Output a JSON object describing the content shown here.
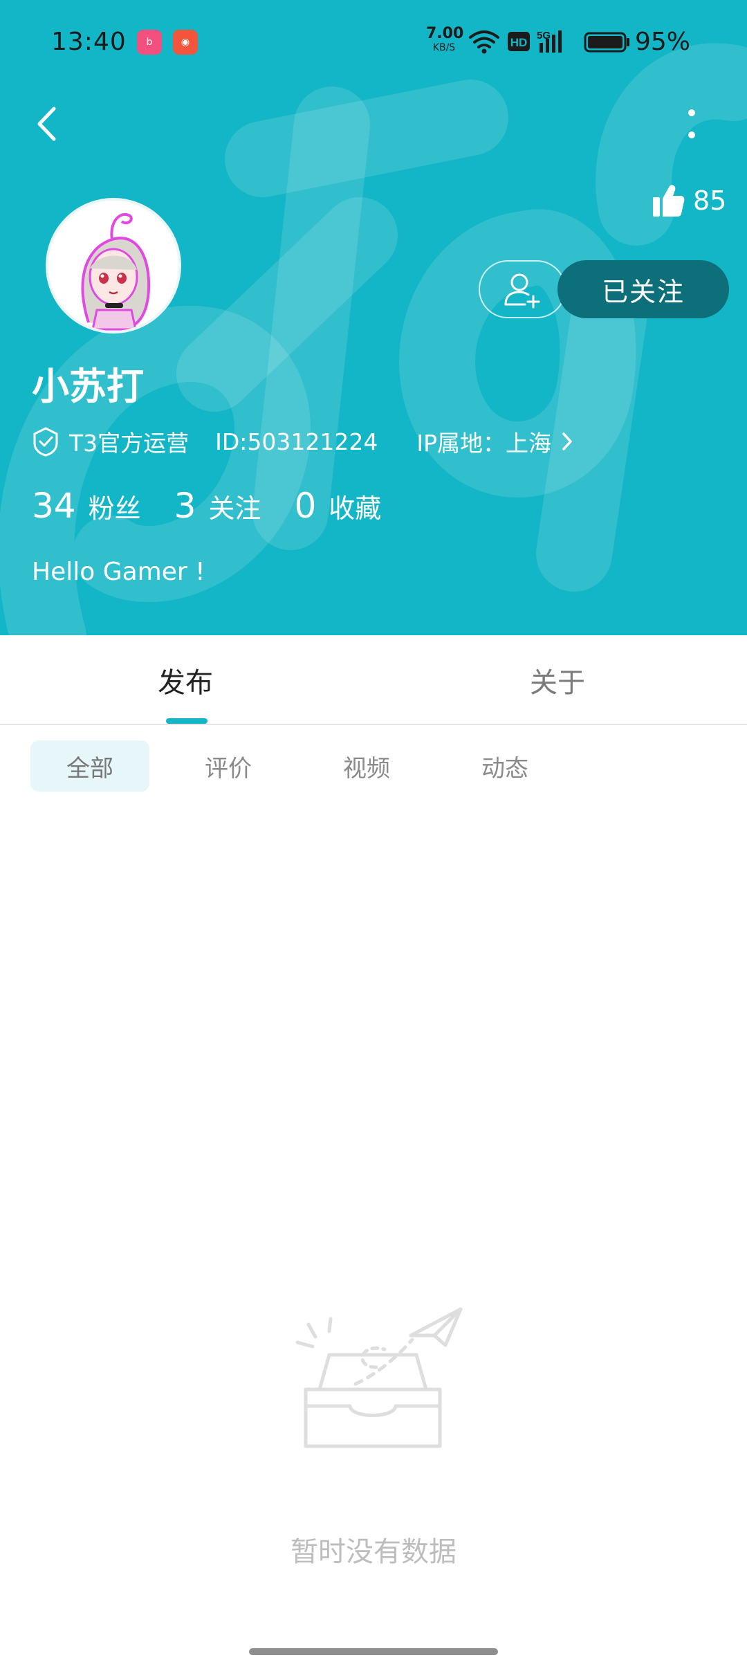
{
  "status_bar": {
    "time": "13:40",
    "net_speed_value": "7.00",
    "net_speed_unit": "KB/S",
    "network": "5G",
    "battery": "95%"
  },
  "header": {
    "likes_count": "85",
    "follow_button": "已关注",
    "username": "小苏打",
    "badge": "T3官方运营",
    "user_id": "ID:503121224",
    "ip_location": "IP属地：上海",
    "stats": [
      {
        "value": "34",
        "label": "粉丝"
      },
      {
        "value": "3",
        "label": "关注"
      },
      {
        "value": "0",
        "label": "收藏"
      }
    ],
    "bio": "Hello Gamer !"
  },
  "tabs": [
    {
      "label": "发布",
      "active": true
    },
    {
      "label": "关于",
      "active": false
    }
  ],
  "filters": [
    {
      "label": "全部",
      "selected": true
    },
    {
      "label": "评价",
      "selected": false
    },
    {
      "label": "视频",
      "selected": false
    },
    {
      "label": "动态",
      "selected": false
    }
  ],
  "empty_state": {
    "message": "暂时没有数据"
  },
  "colors": {
    "header_bg": "#13b6c6",
    "follow_button_bg": "#0d6f7a",
    "tab_indicator": "#13b6c6",
    "selected_chip_bg": "#e6f6f9"
  },
  "icons": [
    "back-arrow-icon",
    "more-vertical-icon",
    "thumbs-up-icon",
    "add-friend-icon",
    "verified-shield-icon",
    "chevron-right-icon",
    "empty-box-icon"
  ]
}
